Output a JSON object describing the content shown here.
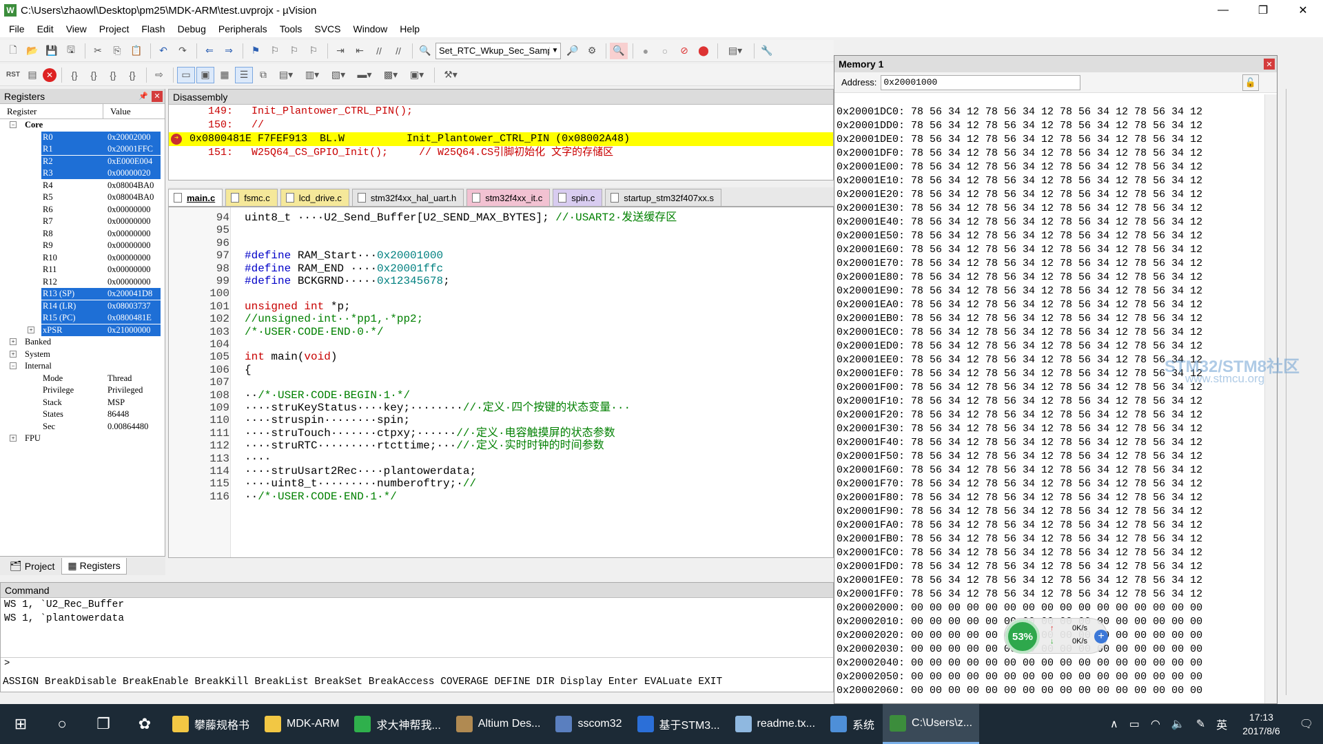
{
  "window": {
    "app_icon": "W",
    "title": "C:\\Users\\zhaowl\\Desktop\\pm25\\MDK-ARM\\test.uvprojx - µVision"
  },
  "menu": [
    "File",
    "Edit",
    "View",
    "Project",
    "Flash",
    "Debug",
    "Peripherals",
    "Tools",
    "SVCS",
    "Window",
    "Help"
  ],
  "toolbar": {
    "target_combo": "Set_RTC_Wkup_Sec_Samp"
  },
  "registers": {
    "title": "Registers",
    "col_register": "Register",
    "col_value": "Value",
    "rows": [
      {
        "name": "Core",
        "value": "",
        "level": 1,
        "tree": "−",
        "sel": false
      },
      {
        "name": "R0",
        "value": "0x20002000",
        "level": 2,
        "sel": true
      },
      {
        "name": "R1",
        "value": "0x20001FFC",
        "level": 2,
        "sel": true
      },
      {
        "name": "R2",
        "value": "0xE000E004",
        "level": 2,
        "sel": true
      },
      {
        "name": "R3",
        "value": "0x00000020",
        "level": 2,
        "sel": true
      },
      {
        "name": "R4",
        "value": "0x08004BA0",
        "level": 2,
        "sel": false
      },
      {
        "name": "R5",
        "value": "0x08004BA0",
        "level": 2,
        "sel": false
      },
      {
        "name": "R6",
        "value": "0x00000000",
        "level": 2,
        "sel": false
      },
      {
        "name": "R7",
        "value": "0x00000000",
        "level": 2,
        "sel": false
      },
      {
        "name": "R8",
        "value": "0x00000000",
        "level": 2,
        "sel": false
      },
      {
        "name": "R9",
        "value": "0x00000000",
        "level": 2,
        "sel": false
      },
      {
        "name": "R10",
        "value": "0x00000000",
        "level": 2,
        "sel": false
      },
      {
        "name": "R11",
        "value": "0x00000000",
        "level": 2,
        "sel": false
      },
      {
        "name": "R12",
        "value": "0x00000000",
        "level": 2,
        "sel": false
      },
      {
        "name": "R13 (SP)",
        "value": "0x200041D8",
        "level": 2,
        "sel": true
      },
      {
        "name": "R14 (LR)",
        "value": "0x08003737",
        "level": 2,
        "sel": true
      },
      {
        "name": "R15 (PC)",
        "value": "0x0800481E",
        "level": 2,
        "sel": true
      },
      {
        "name": "xPSR",
        "value": "0x21000000",
        "level": 2,
        "sel": true,
        "tree": "+"
      },
      {
        "name": "Banked",
        "value": "",
        "level": 1,
        "tree": "+",
        "sel": false
      },
      {
        "name": "System",
        "value": "",
        "level": 1,
        "tree": "+",
        "sel": false
      },
      {
        "name": "Internal",
        "value": "",
        "level": 1,
        "tree": "−",
        "sel": false
      },
      {
        "name": "Mode",
        "value": "Thread",
        "level": 2,
        "sel": false
      },
      {
        "name": "Privilege",
        "value": "Privileged",
        "level": 2,
        "sel": false
      },
      {
        "name": "Stack",
        "value": "MSP",
        "level": 2,
        "sel": false
      },
      {
        "name": "States",
        "value": "86448",
        "level": 2,
        "sel": false
      },
      {
        "name": "Sec",
        "value": "0.00864480",
        "level": 2,
        "sel": false
      },
      {
        "name": "FPU",
        "value": "",
        "level": 1,
        "tree": "+",
        "sel": false
      }
    ],
    "tab_project": "Project",
    "tab_registers": "Registers"
  },
  "disassembly": {
    "title": "Disassembly",
    "lines": [
      {
        "text": "   149:   Init_Plantower_CTRL_PIN();",
        "hl": false
      },
      {
        "text": "   150:   //",
        "hl": false
      },
      {
        "text": "0x0800481E F7FEF913  BL.W          Init_Plantower_CTRL_PIN (0x08002A48)",
        "hl": true
      },
      {
        "text": "   151:   W25Q64_CS_GPIO_Init();     // W25Q64.CS引脚初始化 文字的存储区",
        "hl": false
      }
    ]
  },
  "editor_tabs": [
    {
      "label": "main.c",
      "color": "#f7d56a",
      "active": true
    },
    {
      "label": "fsmc.c",
      "color": "#f5e89a",
      "active": false
    },
    {
      "label": "lcd_drive.c",
      "color": "#f5e89a",
      "active": false
    },
    {
      "label": "stm32f4xx_hal_uart.h",
      "color": "#e4e4e4",
      "active": false
    },
    {
      "label": "stm32f4xx_it.c",
      "color": "#f2c2d2",
      "active": false
    },
    {
      "label": "spin.c",
      "color": "#d8ccf0",
      "active": false
    },
    {
      "label": "startup_stm32f407xx.s",
      "color": "#e4e4e4",
      "active": false
    }
  ],
  "editor": {
    "lines": [
      {
        "n": "94",
        "html": "uint8_t ····U2_Send_Buffer[U2_SEND_MAX_BYTES]; <span class='cm'>//·USART2·发送缓存区</span>"
      },
      {
        "n": "95",
        "html": ""
      },
      {
        "n": "96",
        "html": ""
      },
      {
        "n": "97",
        "html": "<span class='pp'>#define</span> RAM_Start···<span class='num'>0x20001000</span>"
      },
      {
        "n": "98",
        "html": "<span class='pp'>#define</span> RAM_END ····<span class='num'>0x20001ffc</span>"
      },
      {
        "n": "99",
        "html": "<span class='pp'>#define</span> BCKGRND·····<span class='num'>0x12345678</span>;"
      },
      {
        "n": "100",
        "html": ""
      },
      {
        "n": "101",
        "html": "<span class='kw'>unsigned</span> <span class='kw'>int</span> *p;"
      },
      {
        "n": "102",
        "html": "<span class='cm'>//unsigned·int··*pp1,·*pp2;</span>"
      },
      {
        "n": "103",
        "html": "<span class='cm'>/*·USER·CODE·END·0·*/</span>"
      },
      {
        "n": "104",
        "html": ""
      },
      {
        "n": "105",
        "html": "<span class='kw'>int</span> main(<span class='kw'>void</span>)"
      },
      {
        "n": "106",
        "html": "{"
      },
      {
        "n": "107",
        "html": ""
      },
      {
        "n": "108",
        "html": "··<span class='cm'>/*·USER·CODE·BEGIN·1·*/</span>"
      },
      {
        "n": "109",
        "html": "····struKeyStatus····key;········<span class='cm'>//·定义·四个按键的状态变量···</span>"
      },
      {
        "n": "110",
        "html": "····struspin········spin;"
      },
      {
        "n": "111",
        "html": "····struTouch·······ctpxy;······<span class='cm'>//·定义·电容触摸屏的状态参数</span>"
      },
      {
        "n": "112",
        "html": "····struRTC·········rtcttime;···<span class='cm'>//·定义·实时时钟的时间参数</span>"
      },
      {
        "n": "113",
        "html": "····"
      },
      {
        "n": "114",
        "html": "····struUsart2Rec····plantowerdata;"
      },
      {
        "n": "115",
        "html": "····uint8_t·········numberoftry;·<span class='cm'>//</span>"
      },
      {
        "n": "116",
        "html": "··<span class='cm'>/*·USER·CODE·END·1·*/</span>"
      }
    ]
  },
  "command": {
    "title": "Command",
    "history": [
      "WS 1, `U2_Rec_Buffer",
      "WS 1, `plantowerdata"
    ],
    "prompt": ">",
    "help": "ASSIGN BreakDisable BreakEnable BreakKill BreakList BreakSet BreakAccess COVERAGE DEFINE DIR Display Enter EVALuate EXIT"
  },
  "memory": {
    "title": "Memory 1",
    "address_label": "Address:",
    "address_value": "0x20001000",
    "rows": [
      "0x20001DC0: 78 56 34 12 78 56 34 12 78 56 34 12 78 56 34 12",
      "0x20001DD0: 78 56 34 12 78 56 34 12 78 56 34 12 78 56 34 12",
      "0x20001DE0: 78 56 34 12 78 56 34 12 78 56 34 12 78 56 34 12",
      "0x20001DF0: 78 56 34 12 78 56 34 12 78 56 34 12 78 56 34 12",
      "0x20001E00: 78 56 34 12 78 56 34 12 78 56 34 12 78 56 34 12",
      "0x20001E10: 78 56 34 12 78 56 34 12 78 56 34 12 78 56 34 12",
      "0x20001E20: 78 56 34 12 78 56 34 12 78 56 34 12 78 56 34 12",
      "0x20001E30: 78 56 34 12 78 56 34 12 78 56 34 12 78 56 34 12",
      "0x20001E40: 78 56 34 12 78 56 34 12 78 56 34 12 78 56 34 12",
      "0x20001E50: 78 56 34 12 78 56 34 12 78 56 34 12 78 56 34 12",
      "0x20001E60: 78 56 34 12 78 56 34 12 78 56 34 12 78 56 34 12",
      "0x20001E70: 78 56 34 12 78 56 34 12 78 56 34 12 78 56 34 12",
      "0x20001E80: 78 56 34 12 78 56 34 12 78 56 34 12 78 56 34 12",
      "0x20001E90: 78 56 34 12 78 56 34 12 78 56 34 12 78 56 34 12",
      "0x20001EA0: 78 56 34 12 78 56 34 12 78 56 34 12 78 56 34 12",
      "0x20001EB0: 78 56 34 12 78 56 34 12 78 56 34 12 78 56 34 12",
      "0x20001EC0: 78 56 34 12 78 56 34 12 78 56 34 12 78 56 34 12",
      "0x20001ED0: 78 56 34 12 78 56 34 12 78 56 34 12 78 56 34 12",
      "0x20001EE0: 78 56 34 12 78 56 34 12 78 56 34 12 78 56 34 12",
      "0x20001EF0: 78 56 34 12 78 56 34 12 78 56 34 12 78 56 34 12",
      "0x20001F00: 78 56 34 12 78 56 34 12 78 56 34 12 78 56 34 12",
      "0x20001F10: 78 56 34 12 78 56 34 12 78 56 34 12 78 56 34 12",
      "0x20001F20: 78 56 34 12 78 56 34 12 78 56 34 12 78 56 34 12",
      "0x20001F30: 78 56 34 12 78 56 34 12 78 56 34 12 78 56 34 12",
      "0x20001F40: 78 56 34 12 78 56 34 12 78 56 34 12 78 56 34 12",
      "0x20001F50: 78 56 34 12 78 56 34 12 78 56 34 12 78 56 34 12",
      "0x20001F60: 78 56 34 12 78 56 34 12 78 56 34 12 78 56 34 12",
      "0x20001F70: 78 56 34 12 78 56 34 12 78 56 34 12 78 56 34 12",
      "0x20001F80: 78 56 34 12 78 56 34 12 78 56 34 12 78 56 34 12",
      "0x20001F90: 78 56 34 12 78 56 34 12 78 56 34 12 78 56 34 12",
      "0x20001FA0: 78 56 34 12 78 56 34 12 78 56 34 12 78 56 34 12",
      "0x20001FB0: 78 56 34 12 78 56 34 12 78 56 34 12 78 56 34 12",
      "0x20001FC0: 78 56 34 12 78 56 34 12 78 56 34 12 78 56 34 12",
      "0x20001FD0: 78 56 34 12 78 56 34 12 78 56 34 12 78 56 34 12",
      "0x20001FE0: 78 56 34 12 78 56 34 12 78 56 34 12 78 56 34 12",
      "0x20001FF0: 78 56 34 12 78 56 34 12 78 56 34 12 78 56 34 12",
      "0x20002000: 00 00 00 00 00 00 00 00 00 00 00 00 00 00 00 00",
      "0x20002010: 00 00 00 00 00 00 00 00 00 00 00 00 00 00 00 00",
      "0x20002020: 00 00 00 00 00 00 00 00 00 00 00 00 00 00 00 00",
      "0x20002030: 00 00 00 00 00 00 00 00 00 00 00 00 00 00 00 00",
      "0x20002040: 00 00 00 00 00 00 00 00 00 00 00 00 00 00 00 00",
      "0x20002050: 00 00 00 00 00 00 00 00 00 00 00 00 00 00 00 00",
      "0x20002060: 00 00 00 00 00 00 00 00 00 00 00 00 00 00 00 00"
    ]
  },
  "watermark": {
    "line1": "STM32/STM8社区",
    "line2": "www.stmcu.org"
  },
  "net_widget": {
    "percent": "53%",
    "up": "0K/s",
    "down": "0K/s"
  },
  "taskbar": {
    "apps": [
      {
        "label": "攀藤规格书",
        "color": "#f2c744"
      },
      {
        "label": "MDK-ARM",
        "color": "#f2c744"
      },
      {
        "label": "求大神帮我...",
        "color": "#2fb04c"
      },
      {
        "label": "Altium Des...",
        "color": "#b08a52"
      },
      {
        "label": "sscom32",
        "color": "#5a7fbf"
      },
      {
        "label": "基于STM3...",
        "color": "#2b6fd8"
      },
      {
        "label": "readme.tx...",
        "color": "#8fb8e0"
      },
      {
        "label": "系统",
        "color": "#4e8fd8"
      },
      {
        "label": "C:\\Users\\z...",
        "color": "#3c8d3c",
        "active": true
      }
    ],
    "ime": "英",
    "time": "17:13",
    "date": "2017/8/6"
  }
}
